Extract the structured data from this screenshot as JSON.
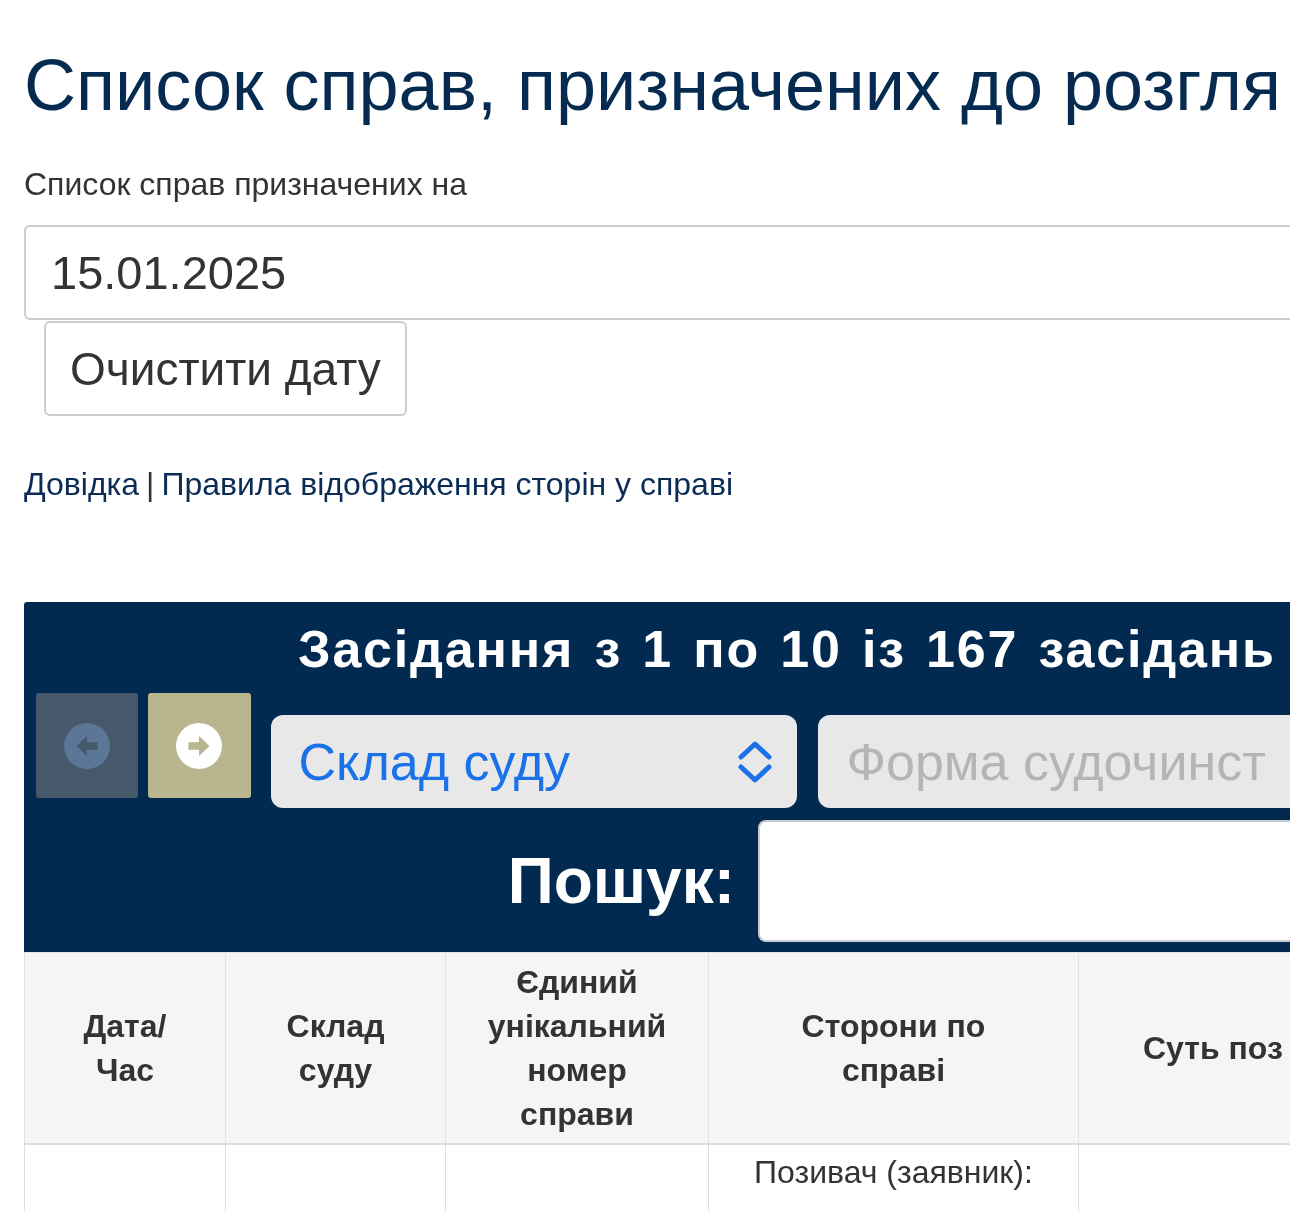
{
  "page": {
    "title": "Список справ, призначених до розгля",
    "date_label": "Список справ призначених на",
    "date_field": {
      "value": "15.01.2025"
    },
    "clear_button": "Очистити дату",
    "links": [
      {
        "label": "Довідка"
      },
      {
        "label": "Правила відображення сторін у справі"
      }
    ],
    "links_separator": "|"
  },
  "panel": {
    "title": "Засідання з 1 по 10 із 167 засідань",
    "pager": [
      {
        "kind": "prev",
        "disabled": true
      },
      {
        "kind": "next",
        "disabled": false
      }
    ],
    "selects": [
      {
        "label": "Склад суду",
        "disabled": false
      },
      {
        "label": "Форма судочинст",
        "disabled": true
      }
    ],
    "search": {
      "label": "Пошук:"
    }
  },
  "table": {
    "columns": [
      "Дата/\nЧас",
      "Склад\nсуду",
      "Єдиний\nунікальний\nномер\nсправи",
      "Сторони по\nсправі",
      "Суть поз"
    ],
    "rows": [
      {
        "parties": "Позивач (заявник):"
      }
    ]
  }
}
